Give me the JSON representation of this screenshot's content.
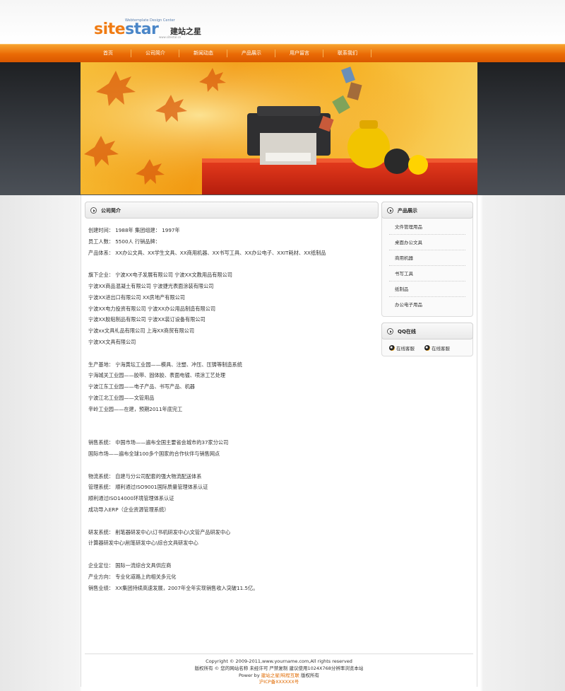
{
  "header": {
    "logo_site": "site",
    "logo_star": "star",
    "logo_cn": "建站之星",
    "logo_tagline": "Webtemplate Design Center",
    "logo_url": "www.sitestar.cn"
  },
  "nav": {
    "items": [
      "首页",
      "公司简介",
      "新闻动态",
      "产品展示",
      "用户留言",
      "联系我们"
    ]
  },
  "main": {
    "title": "公司简介",
    "lines": [
      "创建时间：  1988年  集团组建：   1997年",
      "员工人数：  5500人  行销品牌：",
      "产品体系：  XX办公文具、XX学生文具、XX商用机器、XX书写工具、XX办公电子、XXIT耗材、XX纸制品",
      "",
      "旗下企业：  宁波XX电子发展有限公司  宁波XX文教用品有限公司",
      "宁波XX商品混凝土有限公司  宁波捷光表面涂装有限公司",
      "宁波XX进出口有限公司  XX房地产有限公司",
      "宁波XX电力投资有限公司  宁波XX办公用品制造有限公司",
      "宁波XX胶粘制品有限公司  宁波XX装订设备有限公司",
      "宁波xx文具礼品有限公司  上海XX商贸有限公司",
      "宁波XX文具有限公司",
      "",
      "生产基地：  宁海黄坛工业园——模具、注塑、冲压、压铸等制造系统",
      "宁海城关工业园——胶带、固体胶、表面电镀、喷涂工艺处理",
      "宁波江东工业园——电子产品、书写产品、机器",
      "宁波江北工业园——文管用品",
      "辛岭工业园——在建，预期2011年底完工",
      "",
      "",
      "销售系统：  中国市场——遍布全国主要省会城市的37家分公司",
      "国际市场——遍布全球100多个国家的合作伙伴与销售网点",
      "",
      "物流系统：  自建与分公司配套的强大物流配送体系",
      "管理系统：  顺利通过ISO9001国际质量管理体系认证",
      "顺利通过ISO14000环境管理体系认证",
      "成功导入ERP（企业资源管理系统）",
      "",
      "研发系统：  削笔器研发中心\\订书机研发中心\\文管产品研发中心",
      "计算器研发中心\\削笔研发中心\\综合文具研发中心",
      "",
      "企业定位：  国际一流综合文具供应商",
      "产业方向：  专业化道路上的相关多元化",
      "销售业绩：  XX集团持续高速发展，2007年全年实现销售收入突破11.5亿。"
    ]
  },
  "sidebar": {
    "products_title": "产品展示",
    "products": [
      "文件管理用品",
      "桌面办公文具",
      "商用机器",
      "书写工具",
      "纸制品",
      "办公电子用品"
    ],
    "qq_title": "QQ在线",
    "qq_items": [
      "在线客服",
      "在线客服"
    ]
  },
  "footer": {
    "copyright": "Copyright © 2009-2011,www.yourname.com,All rights reserved",
    "notice": "版权所有  © 您的网站名称  未经许可  严禁复制  建议使用1024X768分辨率浏览本站",
    "power_prefix": "Power by ",
    "power_link": "建站之星|响程互联",
    "power_suffix": " 版权所有",
    "icp": "沪ICP备XXXXXX号"
  },
  "colors": {
    "nav_orange": "#ea6a05",
    "accent_orange": "#e06a00",
    "logo_orange": "#f07c14",
    "logo_blue": "#4a86c8"
  }
}
